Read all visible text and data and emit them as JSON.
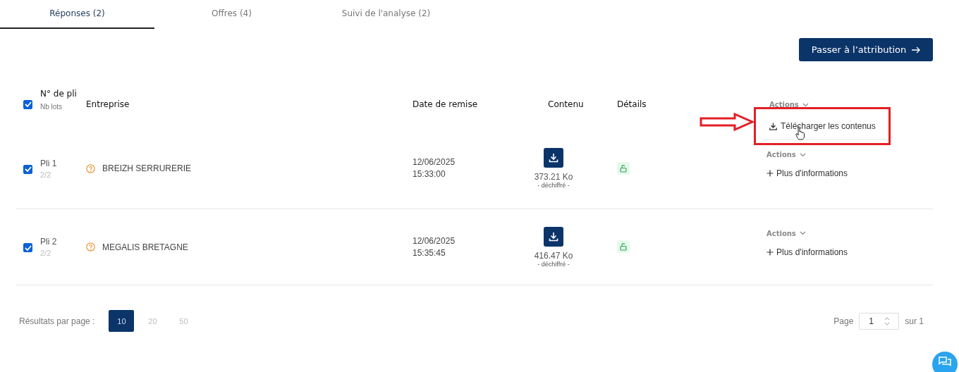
{
  "tabs": [
    {
      "label": "Réponses (2)",
      "selected": true
    },
    {
      "label": "Offres (4)",
      "selected": false
    },
    {
      "label": "Suivi de l'analyse (2)",
      "selected": false
    }
  ],
  "primary_button": {
    "label": "Passer à l’attribution"
  },
  "table": {
    "select_all_checked": true,
    "columns": {
      "number": "N° de pli",
      "lots": "Nb lots",
      "company": "Entreprise",
      "date": "Date de remise",
      "content": "Contenu",
      "details": "Détails",
      "actions": "Actions"
    },
    "actions_menu": {
      "open": true,
      "items": [
        "Télécharger les contenus"
      ]
    },
    "rows": [
      {
        "checked": true,
        "number": "Pli 1",
        "lots": "2/2",
        "company": "BREIZH SERRURERIE",
        "date": "12/06/2025",
        "time": "15:33:00",
        "size": "373.21 Ko",
        "status": "- déchiffré -",
        "actions": "Actions",
        "more": "Plus d'informations"
      },
      {
        "checked": true,
        "number": "Pli 2",
        "lots": "2/2",
        "company": "MEGALIS BRETAGNE",
        "date": "12/06/2025",
        "time": "15:35:45",
        "size": "416.47 Ko",
        "status": "- déchiffré -",
        "actions": "Actions",
        "more": "Plus d'informations"
      }
    ]
  },
  "pagination": {
    "label": "Résultats par page :",
    "sizes": [
      {
        "label": "10",
        "selected": true
      },
      {
        "label": "20",
        "selected": false
      },
      {
        "label": "50",
        "selected": false
      }
    ],
    "page_label": "Page",
    "page_value": "1",
    "total": "sur 1"
  }
}
